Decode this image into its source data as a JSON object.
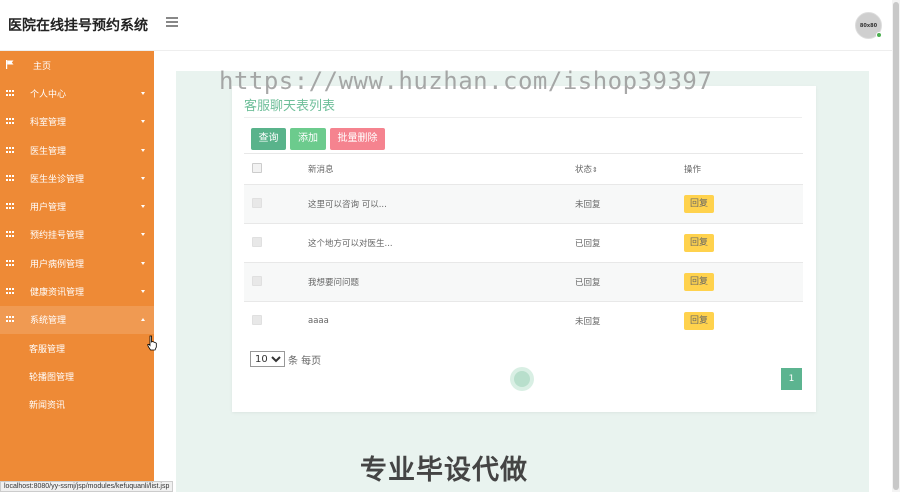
{
  "app": {
    "title": "医院在线挂号预约系统",
    "avatar_text": "80x80"
  },
  "sidebar": {
    "home": "主页",
    "items": [
      {
        "label": "个人中心"
      },
      {
        "label": "科室管理"
      },
      {
        "label": "医生管理"
      },
      {
        "label": "医生坐诊管理"
      },
      {
        "label": "用户管理"
      },
      {
        "label": "预约挂号管理"
      },
      {
        "label": "用户病例管理"
      },
      {
        "label": "健康资讯管理"
      },
      {
        "label": "系统管理"
      }
    ],
    "sub_items": [
      {
        "label": "客服管理"
      },
      {
        "label": "轮播图管理"
      },
      {
        "label": "新闻资讯"
      }
    ]
  },
  "watermark": "https://www.huzhan.com/ishop39397",
  "card": {
    "title": "客服聊天表列表",
    "buttons": {
      "query": "查询",
      "add": "添加",
      "batch_delete": "批量删除"
    },
    "columns": {
      "message": "新消息",
      "status": "状态",
      "action": "操作"
    },
    "rows": [
      {
        "message": "这里可以咨询 可以...",
        "status": "未回复",
        "action": "回复"
      },
      {
        "message": "这个地方可以对医生...",
        "status": "已回复",
        "action": "回复"
      },
      {
        "message": "我想要问问题",
        "status": "已回复",
        "action": "回复"
      },
      {
        "message": "aaaa",
        "status": "未回复",
        "action": "回复"
      }
    ],
    "pager": {
      "page_size": "10",
      "page_size_suffix": "条 每页",
      "current_page": "1"
    }
  },
  "promo_text": "专业毕设代做",
  "status_url": "localhost:8080/yy-ssmj/jsp/modules/kefuquanli/list.jsp",
  "colors": {
    "sidebar": "#ee8a36",
    "accent_green": "#59b38b",
    "delete_pink": "#f5838f",
    "reply_yellow": "#ffd24d"
  }
}
